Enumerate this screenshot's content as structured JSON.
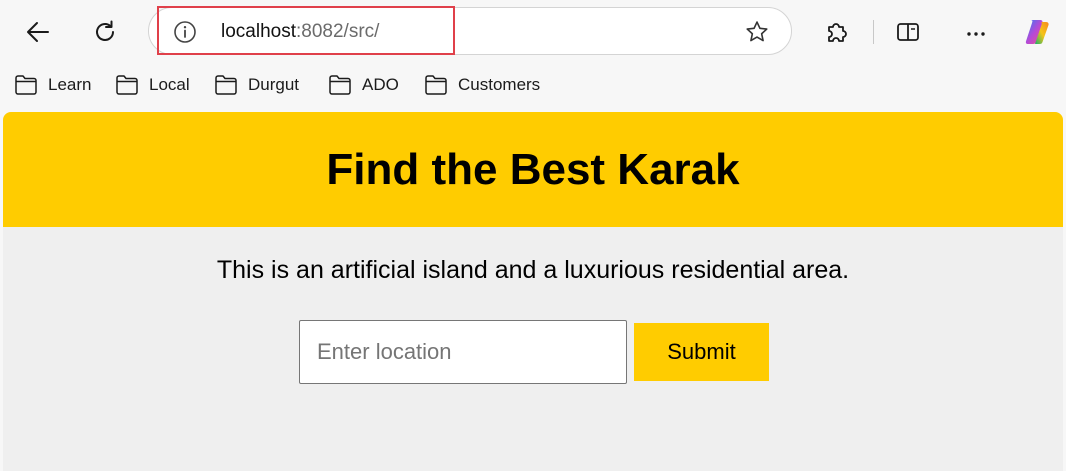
{
  "browser": {
    "address_bar": {
      "host": "localhost",
      "path": ":8082/src/"
    },
    "icons": {
      "back": "arrow-left-icon",
      "reload": "reload-icon",
      "site_info": "info-icon",
      "favorite": "star-icon",
      "extensions": "puzzle-icon",
      "split_screen": "split-screen-icon",
      "more": "more-icon",
      "copilot": "copilot-icon",
      "folder": "folder-icon"
    },
    "highlight_color": "#e0404a"
  },
  "bookmarks": [
    {
      "label": "Learn"
    },
    {
      "label": "Local"
    },
    {
      "label": "Durgut"
    },
    {
      "label": "ADO"
    },
    {
      "label": "Customers"
    }
  ],
  "page": {
    "title": "Find the Best Karak",
    "description": "This is an artificial island and a luxurious residential area.",
    "location_input": {
      "placeholder": "Enter location",
      "value": ""
    },
    "submit_label": "Submit",
    "accent_color": "#ffcc00"
  }
}
